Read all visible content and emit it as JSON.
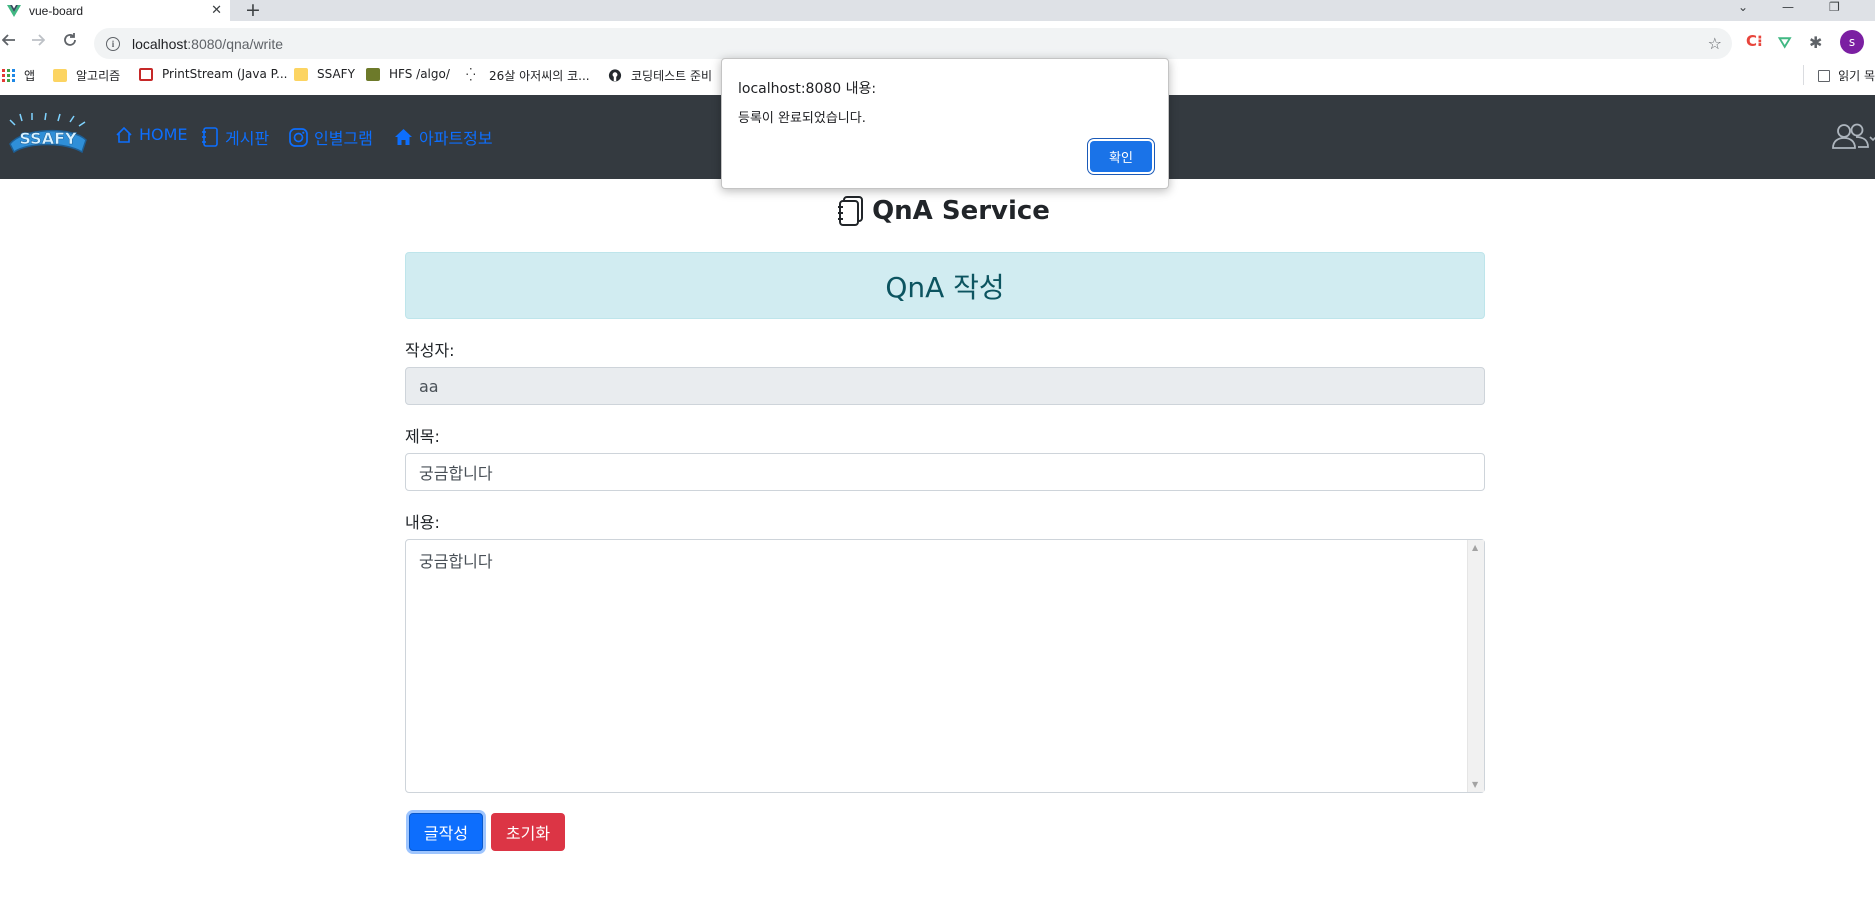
{
  "browser": {
    "tab_title": "vue-board",
    "tab_close": "✕",
    "new_tab": "+",
    "url_host": "localhost",
    "url_path": ":8080/qna/write",
    "window_controls": [
      "⌄",
      "—",
      "❐"
    ],
    "profile_initial": "s",
    "ext_icons": [
      "C⁝",
      "⛛",
      "✱"
    ],
    "bookmarks": [
      "앱",
      "알고리즘",
      "PrintStream (Java P...",
      "SSAFY",
      "HFS /algo/",
      "26살 아저씨의 코...",
      "코딩테스트 준비"
    ],
    "reading_list": "읽기 목"
  },
  "nav": {
    "items": [
      "HOME",
      "게시판",
      "인별그램",
      "아파트정보"
    ]
  },
  "page": {
    "title": "QnA Service",
    "banner": "QnA 작성",
    "author_label": "작성자:",
    "author_value": "aa",
    "subject_label": "제목:",
    "subject_value": "궁금합니다",
    "content_label": "내용:",
    "content_value": "궁금합니다",
    "submit_button": "글작성",
    "reset_button": "초기화"
  },
  "dialog": {
    "title": "localhost:8080 내용:",
    "message": "등록이 완료되었습니다.",
    "ok_button": "확인"
  },
  "colors": {
    "navbar_bg": "#343a40",
    "nav_link": "#0d6efd",
    "banner_bg": "#d1ecf1",
    "banner_text": "#0c5460",
    "primary": "#0d6efd",
    "danger": "#dc3545",
    "dialog_button": "#1a73e8"
  }
}
